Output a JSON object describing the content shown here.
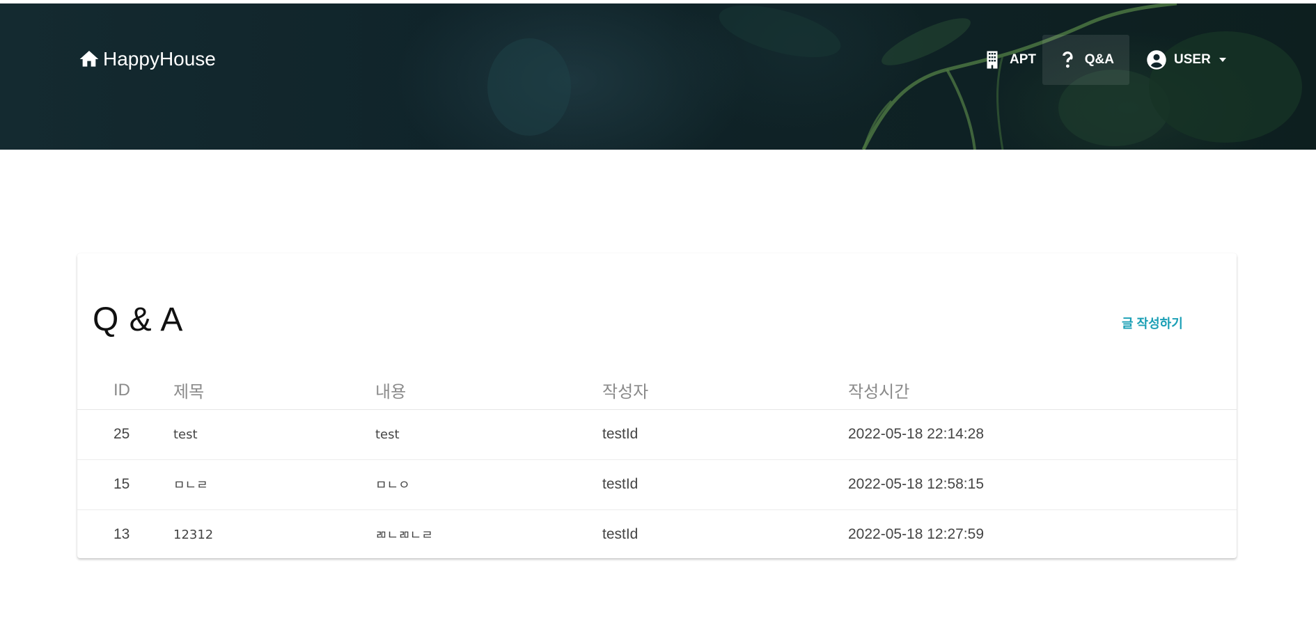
{
  "header": {
    "brand": "HappyHouse",
    "nav": [
      {
        "label": "APT",
        "icon": "building-icon"
      },
      {
        "label": "Q&A",
        "icon": "question-icon",
        "active": true
      },
      {
        "label": "USER",
        "icon": "account-circle-icon"
      }
    ]
  },
  "board": {
    "title": "Q & A",
    "write_button": "글 작성하기",
    "columns": [
      "ID",
      "제목",
      "내용",
      "작성자",
      "작성시간"
    ],
    "rows": [
      {
        "id": "25",
        "title": "test",
        "content": "test",
        "writer": "testId",
        "time": "2022-05-18 22:14:28"
      },
      {
        "id": "15",
        "title": "ㅁㄴㄹ",
        "content": "ㅁㄴㅇ",
        "writer": "testId",
        "time": "2022-05-18 12:58:15"
      },
      {
        "id": "13",
        "title": "12312",
        "content": "ㄻㄴㄻㄴㄹ",
        "writer": "testId",
        "time": "2022-05-18 12:27:59"
      }
    ]
  },
  "colors": {
    "accent": "#1a9fb5",
    "header_bg": "#10242a"
  }
}
